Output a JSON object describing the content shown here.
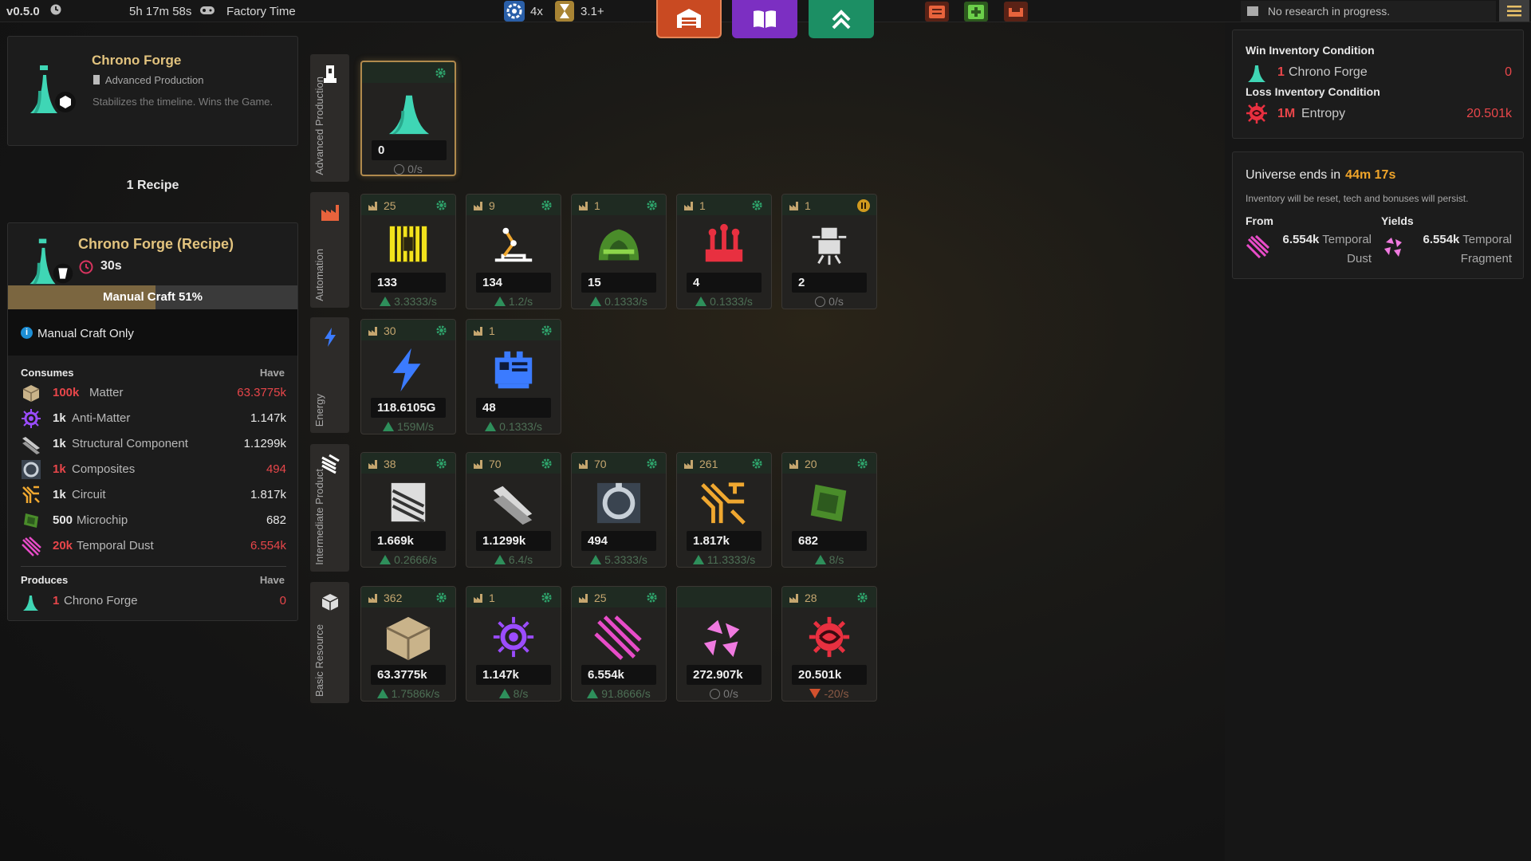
{
  "topbar": {
    "version": "v0.5.0",
    "timer": "5h 17m 58s",
    "factory_time_label": "Factory Time",
    "speed": "4x",
    "version_badge": "3.1+",
    "research_status": "No research in progress."
  },
  "item": {
    "title": "Chrono Forge",
    "category": "Advanced Production",
    "description": "Stabilizes the timeline. Wins the Game."
  },
  "recipes": {
    "count_label": "1 Recipe",
    "title": "Chrono Forge (Recipe)",
    "time": "30s",
    "craft_label": "Manual Craft 51%",
    "craft_progress": 0.51,
    "craft_only": "Manual Craft Only",
    "consumes_label": "Consumes",
    "have_label": "Have",
    "consumes": [
      {
        "amount": "100k",
        "name": "Matter",
        "have": "63.3775k",
        "short": true
      },
      {
        "amount": "1k",
        "name": "Anti-Matter",
        "have": "1.147k",
        "short": false
      },
      {
        "amount": "1k",
        "name": "Structural Component",
        "have": "1.1299k",
        "short": false
      },
      {
        "amount": "1k",
        "name": "Composites",
        "have": "494",
        "short": true
      },
      {
        "amount": "1k",
        "name": "Circuit",
        "have": "1.817k",
        "short": false
      },
      {
        "amount": "500",
        "name": "Microchip",
        "have": "682",
        "short": false
      },
      {
        "amount": "20k",
        "name": "Temporal Dust",
        "have": "6.554k",
        "short": true
      }
    ],
    "produces_label": "Produces",
    "produces": [
      {
        "amount": "1",
        "name": "Chrono Forge",
        "have": "0"
      }
    ]
  },
  "categories": [
    {
      "label": "Advanced Production",
      "icon": "tower-icon"
    },
    {
      "label": "Automation",
      "icon": "factory-icon"
    },
    {
      "label": "Energy",
      "icon": "lightning-icon"
    },
    {
      "label": "Intermediate Product",
      "icon": "plates-icon"
    },
    {
      "label": "Basic Resource",
      "icon": "cube-icon"
    }
  ],
  "tiles": {
    "advanced": [
      {
        "name": "Chrono Forge",
        "factories": "",
        "value": "0",
        "rate": "0/s",
        "trend": "zero",
        "icon": "chrono-forge-icon"
      }
    ],
    "automation": [
      {
        "name": "Assembler",
        "factories": "25",
        "value": "133",
        "rate": "3.3333/s",
        "trend": "up",
        "icon": "assembler-icon"
      },
      {
        "name": "Robot Arm",
        "factories": "9",
        "value": "134",
        "rate": "1.2/s",
        "trend": "up",
        "icon": "robot-arm-icon"
      },
      {
        "name": "Reactor",
        "factories": "1",
        "value": "15",
        "rate": "0.1333/s",
        "trend": "up",
        "icon": "reactor-icon"
      },
      {
        "name": "Refinery",
        "factories": "1",
        "value": "4",
        "rate": "0.1333/s",
        "trend": "up",
        "icon": "refinery-icon"
      },
      {
        "name": "Drone",
        "factories": "1",
        "value": "2",
        "rate": "0/s",
        "trend": "zero",
        "icon": "drone-icon",
        "paused": true
      }
    ],
    "energy": [
      {
        "name": "Energy",
        "factories": "30",
        "value": "118.6105G",
        "rate": "159M/s",
        "trend": "up",
        "icon": "lightning-icon"
      },
      {
        "name": "Generator",
        "factories": "1",
        "value": "48",
        "rate": "0.1333/s",
        "trend": "up",
        "icon": "generator-icon"
      }
    ],
    "intermediate": [
      {
        "name": "Plates",
        "factories": "38",
        "value": "1.669k",
        "rate": "0.2666/s",
        "trend": "up",
        "icon": "plates-icon"
      },
      {
        "name": "Structural Component",
        "factories": "70",
        "value": "1.1299k",
        "rate": "6.4/s",
        "trend": "up",
        "icon": "beam-icon"
      },
      {
        "name": "Composites",
        "factories": "70",
        "value": "494",
        "rate": "5.3333/s",
        "trend": "up",
        "icon": "composites-icon"
      },
      {
        "name": "Circuit",
        "factories": "261",
        "value": "1.817k",
        "rate": "11.3333/s",
        "trend": "up",
        "icon": "circuit-icon"
      },
      {
        "name": "Microchip",
        "factories": "20",
        "value": "682",
        "rate": "8/s",
        "trend": "up",
        "icon": "microchip-icon"
      }
    ],
    "basic": [
      {
        "name": "Matter",
        "factories": "362",
        "value": "63.3775k",
        "rate": "1.7586k/s",
        "trend": "up",
        "icon": "matter-icon"
      },
      {
        "name": "Anti-Matter",
        "factories": "1",
        "value": "1.147k",
        "rate": "8/s",
        "trend": "up",
        "icon": "anti-matter-icon"
      },
      {
        "name": "Temporal Dust",
        "factories": "25",
        "value": "6.554k",
        "rate": "91.8666/s",
        "trend": "up",
        "icon": "temporal-dust-icon"
      },
      {
        "name": "Temporal Fragment",
        "factories": "",
        "value": "272.907k",
        "rate": "0/s",
        "trend": "zero",
        "icon": "temporal-fragment-icon"
      },
      {
        "name": "Entropy",
        "factories": "28",
        "value": "20.501k",
        "rate": "-20/s",
        "trend": "down",
        "icon": "entropy-icon"
      }
    ]
  },
  "win": {
    "win_label": "Win Inventory Condition",
    "win_amount": "1",
    "win_name": "Chrono Forge",
    "win_have": "0",
    "loss_label": "Loss Inventory Condition",
    "loss_amount": "1M",
    "loss_name": "Entropy",
    "loss_have": "20.501k"
  },
  "universe": {
    "title": "Universe ends in",
    "time": "44m 17s",
    "note": "Inventory will be reset, tech and bonuses will persist.",
    "from_label": "From",
    "yields_label": "Yields",
    "from_amount": "6.554k",
    "from_name_1": "Temporal",
    "from_name_2": "Dust",
    "yields_amount": "6.554k",
    "yields_name_1": "Temporal",
    "yields_name_2": "Fragment"
  },
  "colors": {
    "accent_gold": "#e2c37e",
    "danger": "#e8464a",
    "positive": "#2e8f5b",
    "warning": "#f0a52a"
  }
}
